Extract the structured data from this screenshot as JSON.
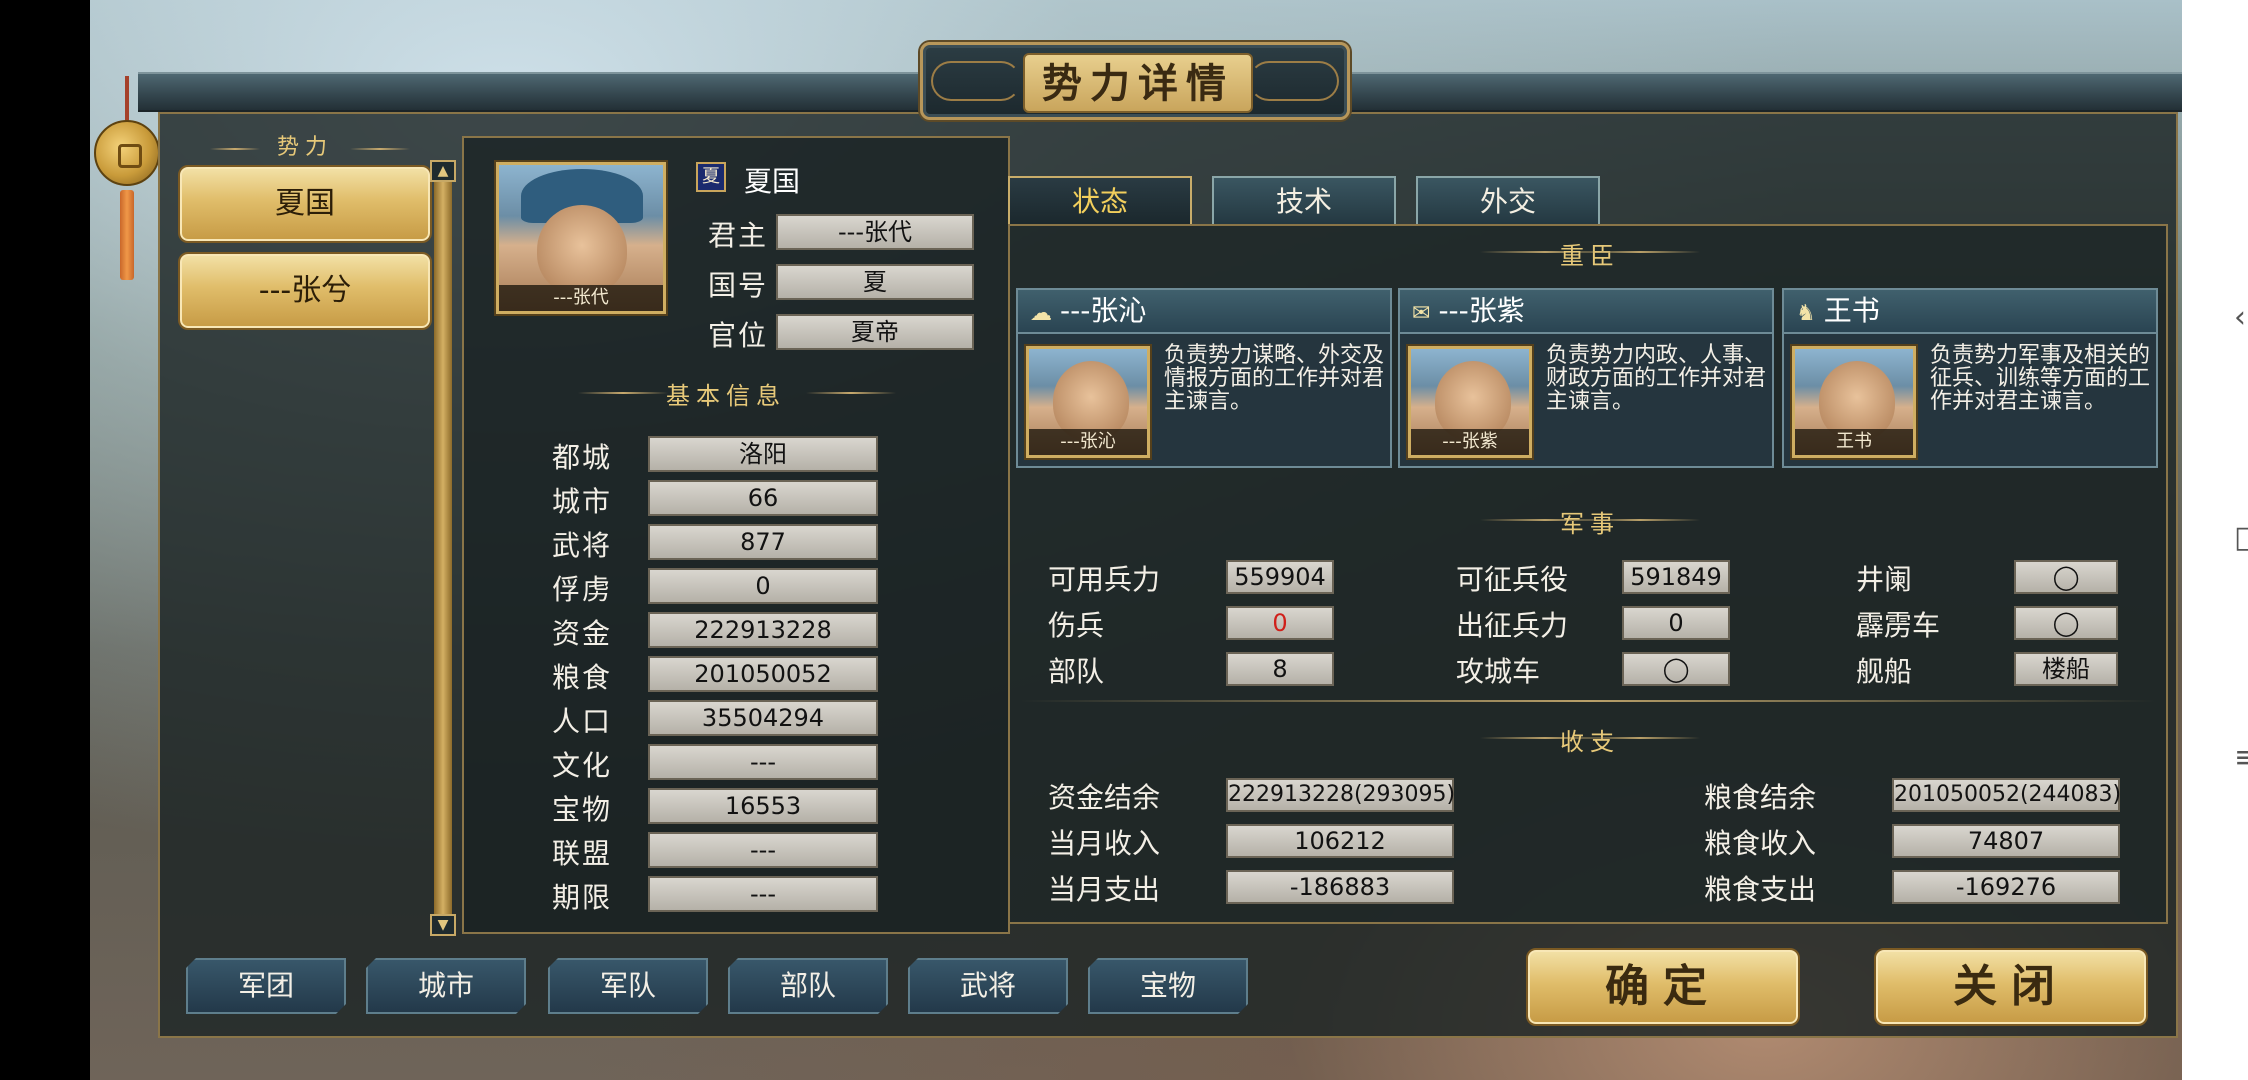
{
  "window": {
    "title": "势力详情"
  },
  "faction_list": {
    "header": "势力",
    "items": [
      {
        "label": "夏国"
      },
      {
        "label": "---张兮"
      }
    ]
  },
  "ruler": {
    "portrait_name": "---张代",
    "flag_char": "夏",
    "faction_name": "夏国",
    "fields": [
      {
        "label": "君主",
        "value": "---张代"
      },
      {
        "label": "国号",
        "value": "夏"
      },
      {
        "label": "官位",
        "value": "夏帝"
      }
    ]
  },
  "basic_info": {
    "title": "基本信息",
    "rows": [
      {
        "label": "都城",
        "value": "洛阳"
      },
      {
        "label": "城市",
        "value": "66"
      },
      {
        "label": "武将",
        "value": "877"
      },
      {
        "label": "俘虏",
        "value": "0"
      },
      {
        "label": "资金",
        "value": "222913228"
      },
      {
        "label": "粮食",
        "value": "201050052"
      },
      {
        "label": "人口",
        "value": "35504294"
      },
      {
        "label": "文化",
        "value": "---"
      },
      {
        "label": "宝物",
        "value": "16553"
      },
      {
        "label": "联盟",
        "value": "---"
      },
      {
        "label": "期限",
        "value": "---"
      }
    ]
  },
  "tabs": [
    {
      "label": "状态"
    },
    {
      "label": "技术"
    },
    {
      "label": "外交"
    }
  ],
  "ministers": {
    "title": "重臣",
    "cards": [
      {
        "icon": "strategy-icon",
        "glyph": "☁",
        "name": "---张沁",
        "portrait_name": "---张沁",
        "desc": "负责势力谋略、外交及情报方面的工作并对君主谏言。"
      },
      {
        "icon": "admin-icon",
        "glyph": "✉",
        "name": "---张紫",
        "portrait_name": "---张紫",
        "desc": "负责势力内政、人事、财政方面的工作并对君主谏言。"
      },
      {
        "icon": "horse-icon",
        "glyph": "♞",
        "name": "王书",
        "portrait_name": "王书",
        "desc": "负责势力军事及相关的征兵、训练等方面的工作并对君主谏言。"
      }
    ]
  },
  "military": {
    "title": "军事",
    "col1": [
      {
        "label": "可用兵力",
        "value": "559904"
      },
      {
        "label": "伤兵",
        "value": "0"
      },
      {
        "label": "部队",
        "value": "8"
      }
    ],
    "col2": [
      {
        "label": "可征兵役",
        "value": "591849"
      },
      {
        "label": "出征兵力",
        "value": "0"
      },
      {
        "label": "攻城车",
        "value": "◯"
      }
    ],
    "col3": [
      {
        "label": "井阑",
        "value": "◯"
      },
      {
        "label": "霹雳车",
        "value": "◯"
      },
      {
        "label": "舰船",
        "value": "楼船"
      }
    ]
  },
  "finance": {
    "title": "收支",
    "left": [
      {
        "label": "资金结余",
        "value": "222913228(293095)"
      },
      {
        "label": "当月收入",
        "value": "106212"
      },
      {
        "label": "当月支出",
        "value": "-186883"
      }
    ],
    "right": [
      {
        "label": "粮食结余",
        "value": "201050052(244083)"
      },
      {
        "label": "粮食收入",
        "value": "74807"
      },
      {
        "label": "粮食支出",
        "value": "-169276"
      }
    ]
  },
  "bottom_nav": [
    {
      "label": "军团"
    },
    {
      "label": "城市"
    },
    {
      "label": "军队"
    },
    {
      "label": "部队"
    },
    {
      "label": "武将"
    },
    {
      "label": "宝物"
    }
  ],
  "actions": {
    "confirm": "确定",
    "close": "关闭"
  },
  "colors": {
    "gold": "#c9a55c",
    "panel": "#1c2424",
    "tab_active_text": "#f2cf5c",
    "injured_red": "#d0201a"
  }
}
